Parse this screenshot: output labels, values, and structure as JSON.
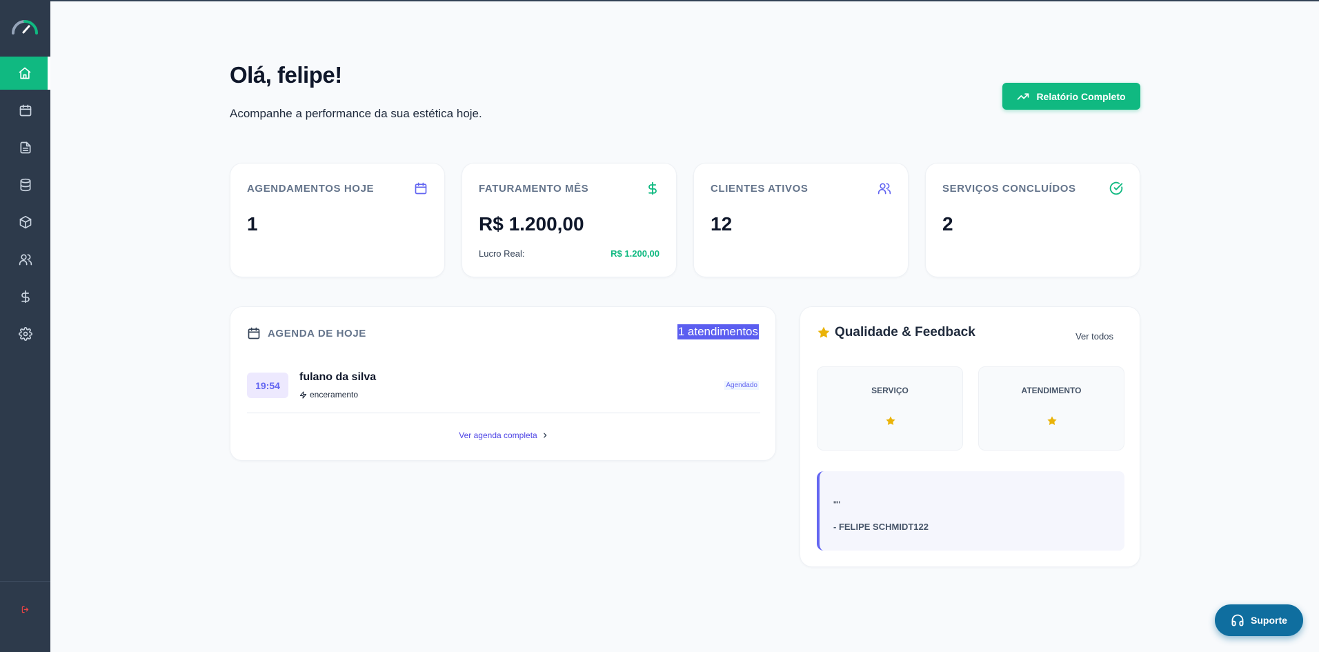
{
  "header": {
    "greeting": "Olá, felipe!",
    "subtitle": "Acompanhe a performance da sua estética hoje.",
    "report_button": "Relatório Completo"
  },
  "sidebar": {
    "items": [
      {
        "icon": "home-icon",
        "active": true
      },
      {
        "icon": "calendar-icon",
        "active": false
      },
      {
        "icon": "document-icon",
        "active": false
      },
      {
        "icon": "database-icon",
        "active": false
      },
      {
        "icon": "box-icon",
        "active": false
      },
      {
        "icon": "users-icon",
        "active": false
      },
      {
        "icon": "dollar-icon",
        "active": false
      },
      {
        "icon": "settings-icon",
        "active": false
      }
    ],
    "logout_icon": "logout-icon"
  },
  "stats": [
    {
      "label": "AGENDAMENTOS HOJE",
      "value": "1",
      "icon": "calendar-icon",
      "icon_color": "#6366f1"
    },
    {
      "label": "FATURAMENTO MÊS",
      "value": "R$ 1.200,00",
      "icon": "dollar-icon",
      "icon_color": "#10b981",
      "profit_label": "Lucro Real:",
      "profit_value": "R$ 1.200,00"
    },
    {
      "label": "CLIENTES ATIVOS",
      "value": "12",
      "icon": "users-icon",
      "icon_color": "#6366f1"
    },
    {
      "label": "SERVIÇOS CONCLUÍDOS",
      "value": "2",
      "icon": "check-circle-icon",
      "icon_color": "#10b981"
    }
  ],
  "agenda": {
    "title": "AGENDA DE HOJE",
    "count": "1 atendimentos",
    "appointments": [
      {
        "time": "19:54",
        "client": "fulano da silva",
        "service": "enceramento",
        "status": "Agendado"
      }
    ],
    "link": "Ver agenda completa"
  },
  "quality": {
    "title": "Qualidade & Feedback",
    "link": "Ver todos",
    "ratings": [
      {
        "label": "SERVIÇO",
        "stars": 1
      },
      {
        "label": "ATENDIMENTO",
        "stars": 1
      }
    ],
    "feedback": {
      "text": "\"\"",
      "author": "- FELIPE SCHMIDT122"
    }
  },
  "support": {
    "label": "Suporte"
  },
  "colors": {
    "brand": "#10b981",
    "sidebar": "#2d3a4b",
    "accent": "#6366f1",
    "support": "#0f6e9f",
    "star": "#eab308"
  }
}
